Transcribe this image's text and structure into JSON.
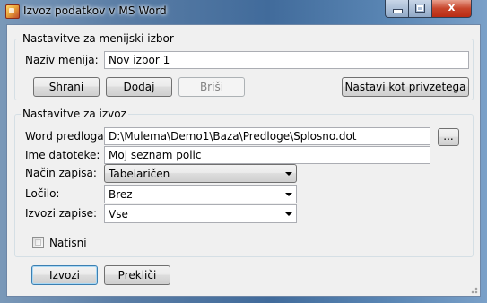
{
  "window": {
    "title": "Izvoz podatkov v MS Word",
    "icon": "app-icon",
    "controls": [
      "minimize-icon",
      "maximize-icon",
      "close-icon"
    ],
    "close_glyph": "x"
  },
  "menu_group": {
    "legend": "Nastavitve za menijski izbor",
    "menu_name_label": "Naziv menija:",
    "menu_name_value": "Nov izbor 1",
    "buttons": {
      "save": "Shrani",
      "add": "Dodaj",
      "delete": "Briši",
      "set_default": "Nastavi kot privzetega"
    }
  },
  "export_group": {
    "legend": "Nastavitve za izvoz",
    "template_label": "Word predloga:",
    "template_value": "D:\\Mulema\\Demo1\\Baza\\Predloge\\Splosno.dot",
    "browse_label": "...",
    "filename_label": "Ime datoteke:",
    "filename_value": "Moj seznam polic",
    "mode_label": "Način zapisa:",
    "mode_value": "Tabelaričen",
    "separator_label": "Ločilo:",
    "separator_value": "Brez",
    "records_label": "Izvozi zapise:",
    "records_value": "Vse",
    "print_label": "Natisni",
    "print_checked": false
  },
  "footer": {
    "export_button": "Izvozi",
    "cancel_button": "Prekliči"
  }
}
